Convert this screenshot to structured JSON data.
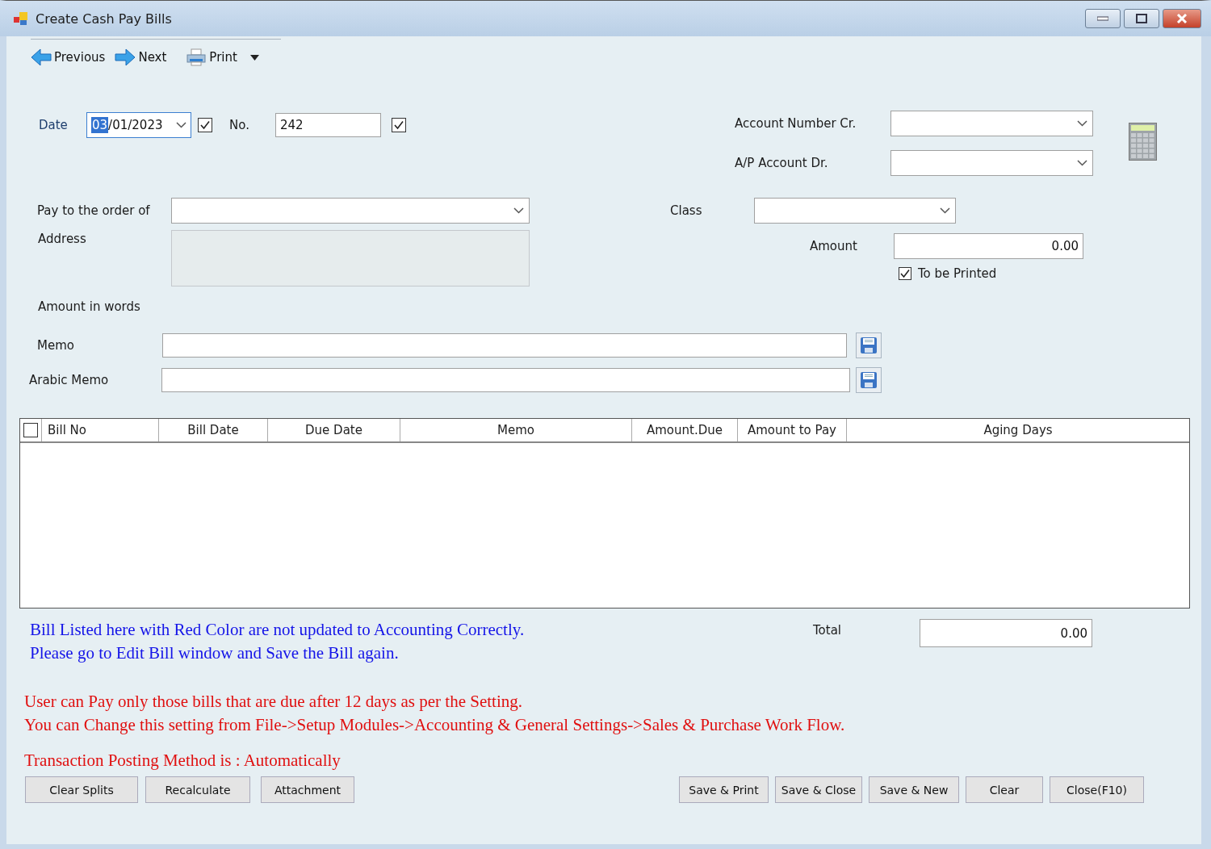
{
  "window": {
    "title": "Create Cash Pay Bills"
  },
  "toolbar": [
    {
      "label": "Previous",
      "kind": "prev"
    },
    {
      "label": "Next",
      "kind": "next"
    },
    {
      "label": "Print",
      "kind": "print"
    }
  ],
  "date": {
    "label": "Date",
    "value": "03/01/2023",
    "checked": true
  },
  "number": {
    "label": "No.",
    "value": "242",
    "checked": true
  },
  "account_cr": {
    "label": "Account Number Cr."
  },
  "ap_account_dr": {
    "label": "A/P Account Dr."
  },
  "pay_to": {
    "label": "Pay to the order of"
  },
  "class": {
    "label": "Class"
  },
  "address": {
    "label": "Address",
    "disabled": true
  },
  "amount": {
    "label": "Amount",
    "value": "0.00"
  },
  "to_be_printed": {
    "label": "To be Printed",
    "checked": true
  },
  "amount_in_words": {
    "label": "Amount in words"
  },
  "memo": {
    "label": "Memo"
  },
  "arabic_memo": {
    "label": "Arabic Memo"
  },
  "table": {
    "select_all_checked": false,
    "columns": [
      {
        "label": "Bill No"
      },
      {
        "label": "Bill Date"
      },
      {
        "label": "Due Date"
      },
      {
        "label": "Memo"
      },
      {
        "label": "Amount.Due"
      },
      {
        "label": "Amount to Pay"
      },
      {
        "label": "Aging Days"
      }
    ]
  },
  "notes": [
    "Bill Listed here with Red Color are not updated to Accounting Correctly.",
    "Please go to Edit Bill window and Save the Bill again."
  ],
  "total": {
    "label": "Total",
    "value": "0.00"
  },
  "warnings": [
    "User can Pay only those bills that are due after 12 days as per the Setting.",
    "You can Change this setting from File->Setup Modules->Accounting & General Settings->Sales & Purchase Work Flow."
  ],
  "posting_method": "Transaction Posting Method is : Automatically",
  "buttons_left": [
    "Clear Splits",
    "Recalculate",
    "Attachment"
  ],
  "buttons_right": [
    "Save & Print",
    "Save & Close",
    "Save & New",
    "Clear",
    "Close(F10)"
  ]
}
